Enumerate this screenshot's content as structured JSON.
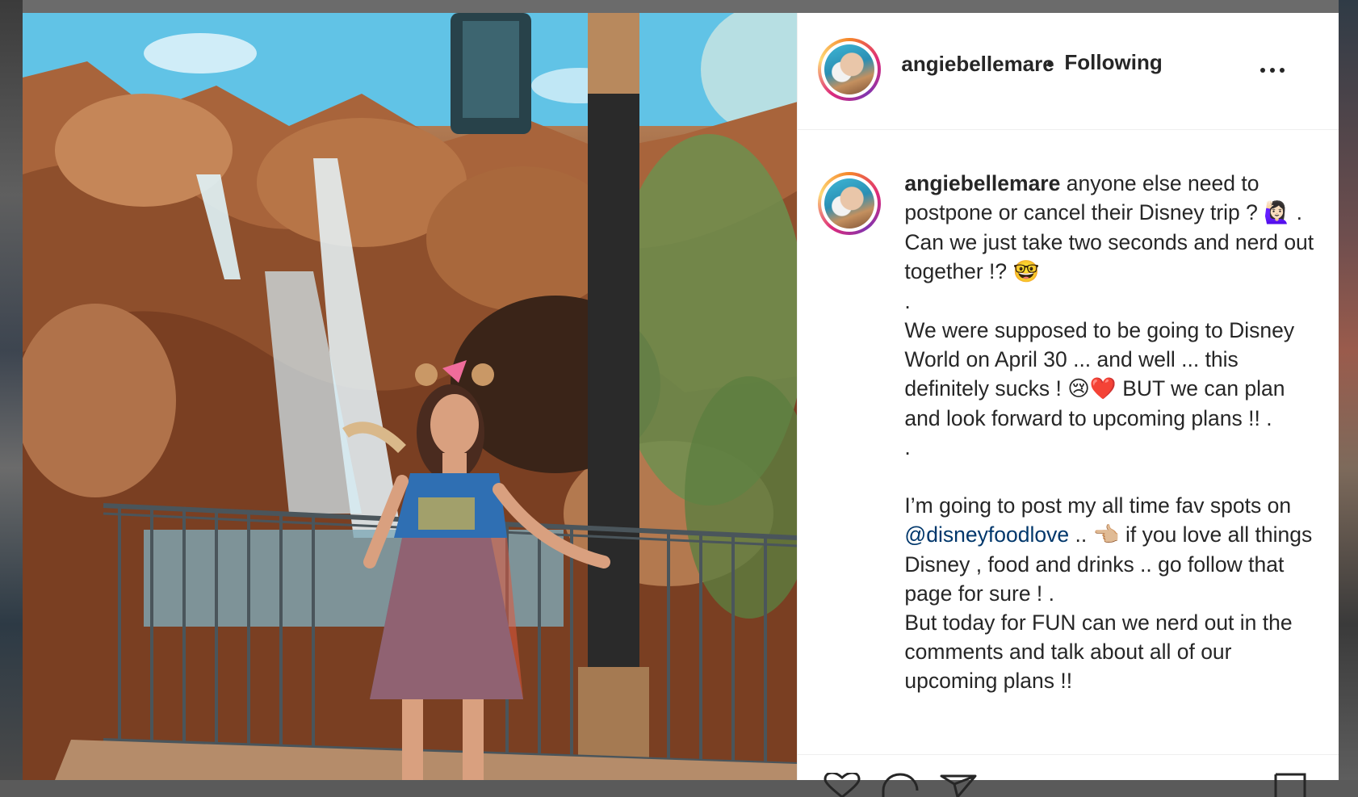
{
  "post": {
    "username": "angiebellemare",
    "separator": "•",
    "follow_state": "Following",
    "caption": {
      "username": "angiebellemare",
      "line1": "anyone else need to postpone or cancel their Disney trip ?",
      "line1_emoji": "🙋🏻‍♀️",
      "line1_end": ".",
      "line2": "Can we just take two seconds and nerd out together !?",
      "line2_emoji": "🤓",
      "dot1": ".",
      "line3a": "We were supposed to be going to Disney World on April 30 ... and well ... this definitely sucks !",
      "line3_emoji": "😢❤️",
      "line3b": "BUT we can plan and look forward to upcoming plans !! .",
      "dot2": ".",
      "line4a": "I’m going to post my all time fav spots on",
      "mention": "@disneyfoodlove",
      "line4b": "..",
      "line4_emoji": "👈🏼",
      "line4c": "if you love all things Disney , food and drinks .. go follow that page for sure ! .",
      "line5": "But today for FUN can we nerd out in the comments and talk about all of our upcoming plans !!"
    }
  },
  "actions": {
    "like_icon": "heart-icon",
    "comment_icon": "comment-icon",
    "share_icon": "paper-plane-icon",
    "save_icon": "bookmark-icon"
  },
  "colors": {
    "text": "#262626",
    "mention": "#00376b",
    "divider": "#efefef"
  }
}
